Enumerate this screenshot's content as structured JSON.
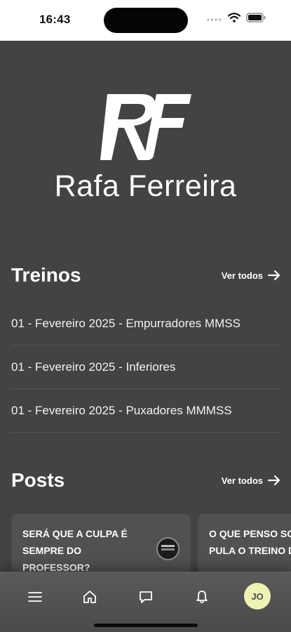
{
  "status_bar": {
    "time": "16:43"
  },
  "logo": {
    "name": "Rafa Ferreira"
  },
  "treinos": {
    "title": "Treinos",
    "see_all": "Ver todos",
    "items": [
      {
        "label": "01 - Fevereiro 2025 - Empurradores MMSS"
      },
      {
        "label": "01 - Fevereiro 2025 - Inferiores"
      },
      {
        "label": "01 - Fevereiro 2025 - Puxadores MMMSS"
      }
    ]
  },
  "posts": {
    "title": "Posts",
    "see_all": "Ver todos",
    "items": [
      {
        "title": "SERÁ QUE A CULPA É SEMPRE DO PROFESSOR?"
      },
      {
        "title": "O QUE PENSO SOBRE QUEM PULA O TREINO DE PERNA."
      }
    ]
  },
  "bottom_nav": {
    "items": [
      {
        "icon": "menu-icon"
      },
      {
        "icon": "home-icon"
      },
      {
        "icon": "chat-icon"
      },
      {
        "icon": "bell-icon"
      }
    ],
    "avatar_initials": "JO"
  },
  "colors": {
    "background": "#434343",
    "avatar_bg": "#eef3b4"
  }
}
